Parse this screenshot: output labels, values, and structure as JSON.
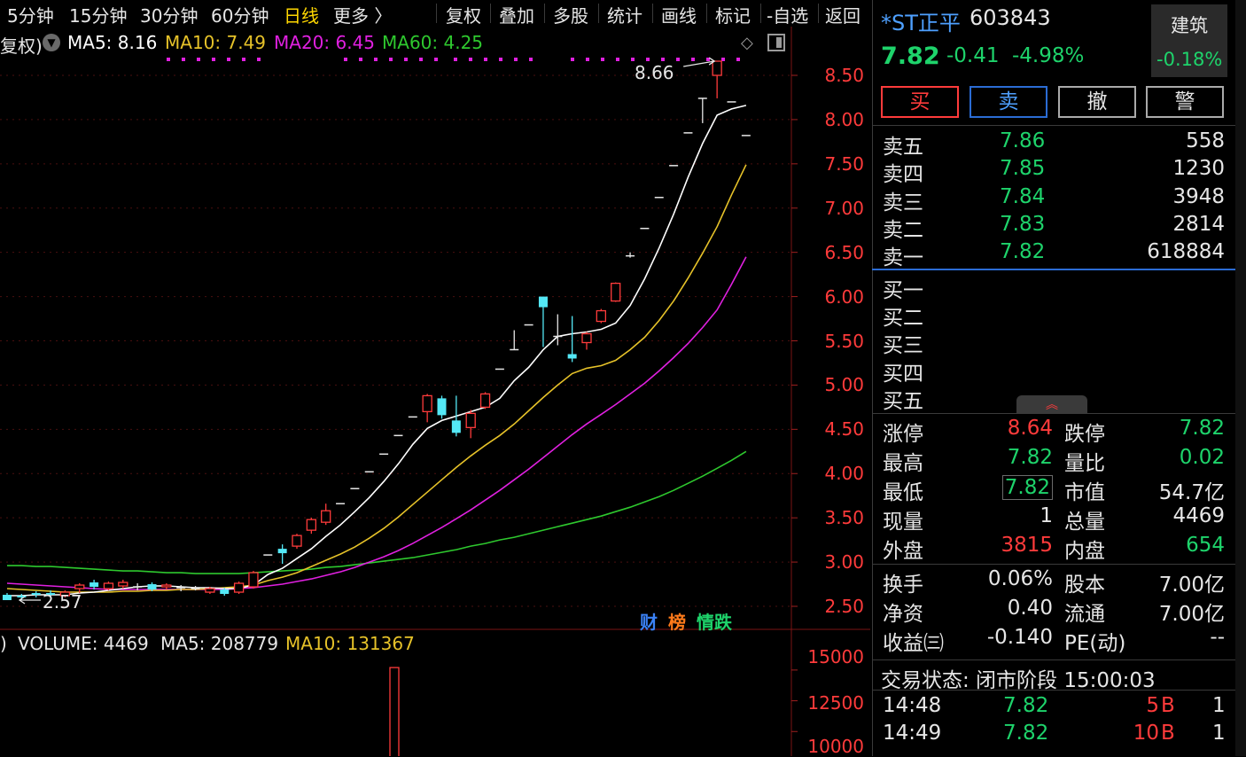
{
  "toolbar": {
    "periods": [
      "5分钟",
      "15分钟",
      "30分钟",
      "60分钟",
      "日线",
      "更多 〉"
    ],
    "active_period": "日线",
    "tools": [
      "复权",
      "叠加",
      "多股",
      "统计",
      "画线",
      "标记",
      "-自选",
      "返回"
    ]
  },
  "chart": {
    "adjust_label": "复权)",
    "ma_legend": [
      {
        "label": "MA5: 8.16",
        "color": "#ffffff"
      },
      {
        "label": "MA10: 7.49",
        "color": "#e6c229"
      },
      {
        "label": "MA20: 6.45",
        "color": "#e020e0"
      },
      {
        "label": "MA60: 4.25",
        "color": "#2ec82e"
      }
    ],
    "high_marker": "8.66",
    "low_marker": "2.57",
    "price_axis": [
      "8.50",
      "8.00",
      "7.50",
      "7.00",
      "6.50",
      "6.00",
      "5.50",
      "5.00",
      "4.50",
      "4.00",
      "3.50",
      "3.00",
      "2.50"
    ],
    "badges": [
      {
        "text": "财",
        "color": "#3b82f6"
      },
      {
        "text": "榜",
        "color": "#ff7a1a"
      },
      {
        "text": "情跌",
        "color": "#1ed36b"
      }
    ],
    "volume_legend": {
      "prefix": ")",
      "volume": "VOLUME: 4469",
      "ma5": "MA5: 208779",
      "ma10": "MA10: 131367"
    },
    "volume_axis": [
      "15000",
      "12500",
      "10000"
    ]
  },
  "chart_data": {
    "type": "candlestick",
    "title": "",
    "ylim": [
      2.3,
      8.8
    ],
    "candles": [
      {
        "o": 2.63,
        "c": 2.57,
        "h": 2.65,
        "l": 2.57
      },
      {
        "o": 2.62,
        "c": 2.6,
        "h": 2.64,
        "l": 2.57
      },
      {
        "o": 2.65,
        "c": 2.63,
        "h": 2.67,
        "l": 2.6
      },
      {
        "o": 2.65,
        "c": 2.63,
        "h": 2.68,
        "l": 2.61
      },
      {
        "o": 2.62,
        "c": 2.66,
        "h": 2.68,
        "l": 2.6
      },
      {
        "o": 2.7,
        "c": 2.74,
        "h": 2.76,
        "l": 2.65
      },
      {
        "o": 2.77,
        "c": 2.72,
        "h": 2.8,
        "l": 2.69
      },
      {
        "o": 2.7,
        "c": 2.76,
        "h": 2.78,
        "l": 2.68
      },
      {
        "o": 2.73,
        "c": 2.77,
        "h": 2.8,
        "l": 2.7
      },
      {
        "o": 2.72,
        "c": 2.72,
        "h": 2.76,
        "l": 2.68
      },
      {
        "o": 2.75,
        "c": 2.69,
        "h": 2.77,
        "l": 2.67
      },
      {
        "o": 2.72,
        "c": 2.74,
        "h": 2.76,
        "l": 2.69
      },
      {
        "o": 2.71,
        "c": 2.71,
        "h": 2.74,
        "l": 2.67
      },
      {
        "o": 2.7,
        "c": 2.7,
        "h": 2.73,
        "l": 2.68
      },
      {
        "o": 2.66,
        "c": 2.7,
        "h": 2.72,
        "l": 2.64
      },
      {
        "o": 2.69,
        "c": 2.64,
        "h": 2.71,
        "l": 2.62
      },
      {
        "o": 2.66,
        "c": 2.76,
        "h": 2.78,
        "l": 2.64
      },
      {
        "o": 2.72,
        "c": 2.88,
        "h": 2.9,
        "l": 2.7
      },
      {
        "o": 3.08,
        "c": 3.08,
        "h": 3.08,
        "l": 3.08
      },
      {
        "o": 3.15,
        "c": 3.1,
        "h": 3.2,
        "l": 2.98
      },
      {
        "o": 3.18,
        "c": 3.3,
        "h": 3.32,
        "l": 3.15
      },
      {
        "o": 3.36,
        "c": 3.48,
        "h": 3.5,
        "l": 3.32
      },
      {
        "o": 3.45,
        "c": 3.58,
        "h": 3.66,
        "l": 3.42
      },
      {
        "o": 3.66,
        "c": 3.66,
        "h": 3.66,
        "l": 3.66
      },
      {
        "o": 3.83,
        "c": 3.83,
        "h": 3.83,
        "l": 3.83
      },
      {
        "o": 4.02,
        "c": 4.02,
        "h": 4.02,
        "l": 4.02
      },
      {
        "o": 4.22,
        "c": 4.22,
        "h": 4.22,
        "l": 4.22
      },
      {
        "o": 4.43,
        "c": 4.43,
        "h": 4.43,
        "l": 4.43
      },
      {
        "o": 4.64,
        "c": 4.64,
        "h": 4.64,
        "l": 4.64
      },
      {
        "o": 4.7,
        "c": 4.88,
        "h": 4.9,
        "l": 4.58
      },
      {
        "o": 4.85,
        "c": 4.66,
        "h": 4.88,
        "l": 4.62
      },
      {
        "o": 4.6,
        "c": 4.46,
        "h": 4.88,
        "l": 4.42
      },
      {
        "o": 4.52,
        "c": 4.68,
        "h": 4.72,
        "l": 4.4
      },
      {
        "o": 4.75,
        "c": 4.9,
        "h": 4.92,
        "l": 4.73
      },
      {
        "o": 5.18,
        "c": 5.18,
        "h": 5.18,
        "l": 5.18
      },
      {
        "o": 5.4,
        "c": 5.4,
        "h": 5.62,
        "l": 5.4
      },
      {
        "o": 5.68,
        "c": 5.68,
        "h": 5.68,
        "l": 5.68
      },
      {
        "o": 6.0,
        "c": 5.88,
        "h": 6.0,
        "l": 5.43
      },
      {
        "o": 5.55,
        "c": 5.55,
        "h": 5.8,
        "l": 5.45
      },
      {
        "o": 5.35,
        "c": 5.3,
        "h": 5.78,
        "l": 5.26
      },
      {
        "o": 5.48,
        "c": 5.58,
        "h": 5.6,
        "l": 5.4
      },
      {
        "o": 5.72,
        "c": 5.84,
        "h": 5.86,
        "l": 5.7
      },
      {
        "o": 5.95,
        "c": 6.15,
        "h": 6.16,
        "l": 5.94
      },
      {
        "o": 6.46,
        "c": 6.46,
        "h": 6.5,
        "l": 6.44
      },
      {
        "o": 6.77,
        "c": 6.77,
        "h": 6.77,
        "l": 6.77
      },
      {
        "o": 7.12,
        "c": 7.12,
        "h": 7.12,
        "l": 7.12
      },
      {
        "o": 7.48,
        "c": 7.48,
        "h": 7.48,
        "l": 7.48
      },
      {
        "o": 7.85,
        "c": 7.85,
        "h": 7.85,
        "l": 7.85
      },
      {
        "o": 8.24,
        "c": 8.24,
        "h": 8.24,
        "l": 7.96
      },
      {
        "o": 8.5,
        "c": 8.66,
        "h": 8.66,
        "l": 8.24
      },
      {
        "o": 8.2,
        "c": 8.2,
        "h": 8.2,
        "l": 8.2
      },
      {
        "o": 7.82,
        "c": 7.82,
        "h": 7.82,
        "l": 7.82
      }
    ],
    "ma5": [
      2.62,
      2.62,
      2.63,
      2.63,
      2.63,
      2.65,
      2.66,
      2.68,
      2.7,
      2.72,
      2.73,
      2.73,
      2.72,
      2.71,
      2.71,
      2.7,
      2.7,
      2.74,
      2.86,
      2.93,
      3.04,
      3.15,
      3.29,
      3.42,
      3.57,
      3.73,
      3.91,
      4.11,
      4.33,
      4.51,
      4.6,
      4.65,
      4.7,
      4.75,
      4.85,
      5.05,
      5.2,
      5.4,
      5.55,
      5.58,
      5.6,
      5.63,
      5.7,
      5.9,
      6.2,
      6.55,
      6.93,
      7.35,
      7.73,
      8.05,
      8.12,
      8.16
    ],
    "ma10": [
      2.7,
      2.69,
      2.68,
      2.67,
      2.66,
      2.66,
      2.66,
      2.66,
      2.67,
      2.67,
      2.68,
      2.68,
      2.69,
      2.69,
      2.7,
      2.71,
      2.72,
      2.74,
      2.79,
      2.83,
      2.88,
      2.95,
      3.02,
      3.09,
      3.17,
      3.27,
      3.38,
      3.51,
      3.65,
      3.79,
      3.93,
      4.07,
      4.2,
      4.32,
      4.43,
      4.56,
      4.71,
      4.86,
      5.0,
      5.13,
      5.19,
      5.22,
      5.28,
      5.4,
      5.54,
      5.73,
      5.95,
      6.21,
      6.49,
      6.79,
      7.15,
      7.49
    ],
    "ma20": [
      2.76,
      2.75,
      2.74,
      2.73,
      2.72,
      2.71,
      2.7,
      2.69,
      2.69,
      2.69,
      2.69,
      2.69,
      2.69,
      2.69,
      2.69,
      2.69,
      2.7,
      2.71,
      2.73,
      2.75,
      2.78,
      2.81,
      2.85,
      2.89,
      2.94,
      3.0,
      3.06,
      3.13,
      3.21,
      3.3,
      3.39,
      3.49,
      3.59,
      3.7,
      3.81,
      3.93,
      4.05,
      4.18,
      4.31,
      4.44,
      4.56,
      4.67,
      4.78,
      4.9,
      5.02,
      5.16,
      5.31,
      5.47,
      5.65,
      5.85,
      6.14,
      6.45
    ],
    "ma60": [
      2.96,
      2.96,
      2.95,
      2.95,
      2.94,
      2.93,
      2.92,
      2.91,
      2.9,
      2.9,
      2.89,
      2.88,
      2.88,
      2.87,
      2.87,
      2.87,
      2.87,
      2.88,
      2.89,
      2.9,
      2.91,
      2.92,
      2.94,
      2.95,
      2.97,
      2.99,
      3.01,
      3.03,
      3.05,
      3.08,
      3.11,
      3.14,
      3.18,
      3.21,
      3.25,
      3.28,
      3.32,
      3.36,
      3.4,
      3.44,
      3.48,
      3.52,
      3.57,
      3.62,
      3.68,
      3.74,
      3.81,
      3.89,
      3.97,
      4.06,
      4.15,
      4.25
    ],
    "volume_ylim": [
      8000,
      16000
    ],
    "volume_last": 15200
  },
  "quote": {
    "name": "*ST正平",
    "code": "603843",
    "price": "7.82",
    "change": "-0.41",
    "change_pct": "-4.98%",
    "sector": "建筑",
    "sector_change": "-0.18%",
    "buttons": [
      "买",
      "卖",
      "撤",
      "警"
    ]
  },
  "order_book": {
    "asks": [
      {
        "label": "卖五",
        "price": "7.86",
        "vol": "558"
      },
      {
        "label": "卖四",
        "price": "7.85",
        "vol": "1230"
      },
      {
        "label": "卖三",
        "price": "7.84",
        "vol": "3948"
      },
      {
        "label": "卖二",
        "price": "7.83",
        "vol": "2814"
      },
      {
        "label": "卖一",
        "price": "7.82",
        "vol": "618884"
      }
    ],
    "bids": [
      {
        "label": "买一",
        "price": "",
        "vol": ""
      },
      {
        "label": "买二",
        "price": "",
        "vol": ""
      },
      {
        "label": "买三",
        "price": "",
        "vol": ""
      },
      {
        "label": "买四",
        "price": "",
        "vol": ""
      },
      {
        "label": "买五",
        "price": "",
        "vol": ""
      }
    ]
  },
  "stats": [
    {
      "l1": "涨停",
      "v1": "8.64",
      "c1": "red",
      "l2": "跌停",
      "v2": "7.82",
      "c2": "green"
    },
    {
      "l1": "最高",
      "v1": "7.82",
      "c1": "green",
      "l2": "量比",
      "v2": "0.02",
      "c2": "green"
    },
    {
      "l1": "最低",
      "v1": "7.82",
      "c1": "green",
      "l2": "市值",
      "v2": "54.7亿",
      "c2": "white"
    },
    {
      "l1": "现量",
      "v1": "1",
      "c1": "white",
      "l2": "总量",
      "v2": "4469",
      "c2": "white"
    },
    {
      "l1": "外盘",
      "v1": "3815",
      "c1": "red",
      "l2": "内盘",
      "v2": "654",
      "c2": "green"
    }
  ],
  "fundamentals": [
    {
      "l1": "换手",
      "v1": "0.06%",
      "l2": "股本",
      "v2": "7.00亿"
    },
    {
      "l1": "净资",
      "v1": "0.40",
      "l2": "流通",
      "v2": "7.00亿"
    },
    {
      "l1": "收益㈢",
      "v1": "-0.140",
      "l2": "PE(动)",
      "v2": "--"
    }
  ],
  "trade_status": "交易状态: 闭市阶段 15:00:03",
  "ticks": [
    {
      "time": "14:48",
      "price": "7.82",
      "vol": "5",
      "side": "B",
      "count": "1"
    },
    {
      "time": "14:49",
      "price": "7.82",
      "vol": "10",
      "side": "B",
      "count": "1"
    }
  ]
}
